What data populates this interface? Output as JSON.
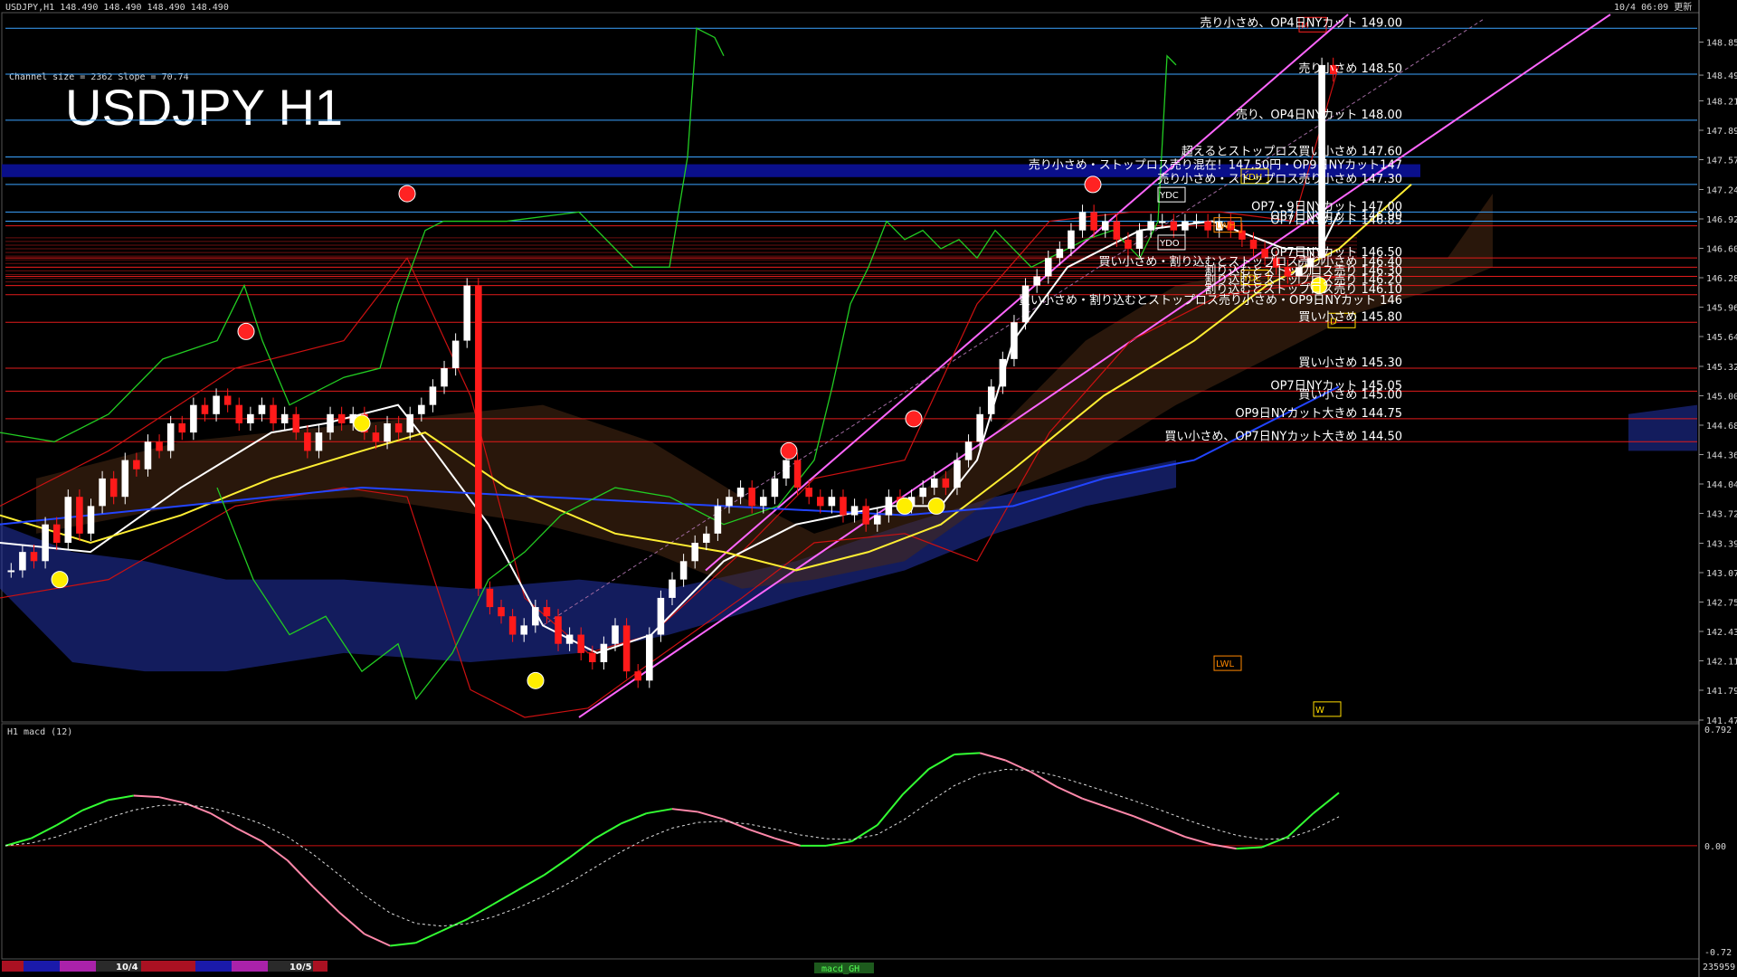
{
  "header": {
    "symbol_line": "USDJPY,H1  148.490 148.490 148.490 148.490",
    "timestamp": "10/4 06:09 更新",
    "channel_info": "Channel size = 2362 Slope = 70.74",
    "chart_title": "USDJPY H1"
  },
  "macd_header": "H1  macd (12)",
  "macd_tag": "macd_GH",
  "corner_counter": "235959",
  "chart_data": {
    "type": "line",
    "title": "USDJPY H1",
    "price_axis": {
      "ylim": [
        141.47,
        149.17
      ],
      "ticks": [
        "148.850",
        "148.490",
        "148.210",
        "147.890",
        "147.570",
        "147.245",
        "146.925",
        "146.605",
        "146.285",
        "145.965",
        "145.645",
        "145.320",
        "145.000",
        "144.680",
        "144.360",
        "144.040",
        "143.720",
        "143.395",
        "143.075",
        "142.755",
        "142.435",
        "142.115",
        "141.795",
        "141.470"
      ]
    },
    "macd_axis": {
      "ticks": [
        "0.792",
        "0.00",
        "-0.72"
      ],
      "ylim": [
        -0.72,
        0.792
      ]
    },
    "date_labels": [
      "10/4",
      "10/5"
    ],
    "price_series": {
      "name": "USDJPY",
      "close": [
        143.1,
        143.3,
        143.2,
        143.6,
        143.4,
        143.9,
        143.5,
        143.8,
        144.1,
        143.9,
        144.3,
        144.2,
        144.5,
        144.4,
        144.7,
        144.6,
        144.9,
        144.8,
        145.0,
        144.9,
        144.7,
        144.8,
        144.9,
        144.7,
        144.8,
        144.6,
        144.4,
        144.6,
        144.8,
        144.7,
        144.8,
        144.6,
        144.5,
        144.7,
        144.6,
        144.8,
        144.9,
        145.1,
        145.3,
        145.6,
        146.2,
        142.9,
        142.7,
        142.6,
        142.4,
        142.5,
        142.7,
        142.6,
        142.3,
        142.4,
        142.2,
        142.1,
        142.3,
        142.5,
        142.0,
        141.9,
        142.4,
        142.8,
        143.0,
        143.2,
        143.4,
        143.5,
        143.8,
        143.9,
        144.0,
        143.8,
        143.9,
        144.1,
        144.3,
        144.0,
        143.9,
        143.8,
        143.9,
        143.7,
        143.8,
        143.6,
        143.7,
        143.9,
        143.8,
        143.9,
        144.0,
        144.1,
        144.0,
        144.3,
        144.5,
        144.8,
        145.1,
        145.4,
        145.8,
        146.2,
        146.3,
        146.5,
        146.6,
        146.8,
        147.0,
        146.8,
        146.9,
        146.7,
        146.6,
        146.8,
        146.9,
        146.9,
        146.8,
        146.9,
        146.9,
        146.8,
        146.9,
        146.8,
        146.7,
        146.6,
        146.5,
        146.4,
        146.3,
        146.4,
        146.5,
        148.6,
        148.5
      ]
    },
    "macd_series": {
      "name": "macd (12)",
      "values": [
        0.0,
        0.05,
        0.14,
        0.24,
        0.31,
        0.34,
        0.33,
        0.29,
        0.22,
        0.12,
        0.03,
        -0.1,
        -0.28,
        -0.45,
        -0.6,
        -0.68,
        -0.66,
        -0.58,
        -0.5,
        -0.4,
        -0.3,
        -0.2,
        -0.08,
        0.05,
        0.15,
        0.22,
        0.25,
        0.23,
        0.18,
        0.11,
        0.05,
        0.0,
        0.0,
        0.03,
        0.14,
        0.35,
        0.52,
        0.62,
        0.63,
        0.58,
        0.5,
        0.4,
        0.32,
        0.26,
        0.2,
        0.13,
        0.06,
        0.01,
        -0.02,
        -0.01,
        0.06,
        0.22,
        0.36
      ]
    },
    "horizontal_levels": [
      {
        "price": 149.0,
        "color": "#3ba3ff"
      },
      {
        "price": 148.5,
        "color": "#3ba3ff"
      },
      {
        "price": 148.0,
        "color": "#3ba3ff"
      },
      {
        "price": 147.6,
        "color": "#3ba3ff"
      },
      {
        "price": 147.3,
        "color": "#3ba3ff"
      },
      {
        "price": 147.0,
        "color": "#3ba3ff"
      },
      {
        "price": 146.9,
        "color": "#3ba3ff"
      },
      {
        "price": 146.85,
        "color": "#e21b1b"
      },
      {
        "price": 146.5,
        "color": "#e21b1b"
      },
      {
        "price": 146.4,
        "color": "#e21b1b"
      },
      {
        "price": 146.3,
        "color": "#e21b1b"
      },
      {
        "price": 146.2,
        "color": "#e21b1b"
      },
      {
        "price": 146.1,
        "color": "#e21b1b"
      },
      {
        "price": 145.8,
        "color": "#e21b1b"
      },
      {
        "price": 145.3,
        "color": "#e21b1b"
      },
      {
        "price": 145.05,
        "color": "#e21b1b"
      },
      {
        "price": 144.75,
        "color": "#e21b1b"
      },
      {
        "price": 144.5,
        "color": "#e21b1b"
      }
    ],
    "annotations": [
      {
        "text": "売り小さめ、OP4日NYカット 149.00",
        "price": 149.0
      },
      {
        "text": "売り小さめ 148.50",
        "price": 148.5
      },
      {
        "text": "売り、OP4日NYカット 148.00",
        "price": 148.0
      },
      {
        "text": "超えるとストップロス買い小さめ 147.60",
        "price": 147.6
      },
      {
        "text": "売り小さめ・ストップロス売り混在！147.50円・OP9日NYカット147",
        "price": 147.45
      },
      {
        "text": "売り小さめ・ストップロス売り小さめ 147.30",
        "price": 147.3
      },
      {
        "text": "OP7・9日NYカット 147.00",
        "price": 147.0
      },
      {
        "text": "OP7日NYカット 146.90",
        "price": 146.9
      },
      {
        "text": "OP7日NYカット 146.85",
        "price": 146.85
      },
      {
        "text": "OP7日NYカット 146.50",
        "price": 146.5
      },
      {
        "text": "買い小さめ・割り込むとストップロス売り小さめ 146.40",
        "price": 146.4
      },
      {
        "text": "割り込むとストップロス売り 146.30",
        "price": 146.3
      },
      {
        "text": "割り込むとストップロス売り 146.20",
        "price": 146.2
      },
      {
        "text": "割り込むとストップロス売り 146.10",
        "price": 146.1
      },
      {
        "text": "買い小さめ・割り込むとストップロス売り小さめ・OP9日NYカット 146",
        "price": 145.98
      },
      {
        "text": "買い小さめ 145.80",
        "price": 145.8
      },
      {
        "text": "買い小さめ 145.30",
        "price": 145.3
      },
      {
        "text": "OP7日NYカット 145.05",
        "price": 145.05
      },
      {
        "text": "買い小さめ 145.00",
        "price": 144.95
      },
      {
        "text": "OP9日NYカット大きめ 144.75",
        "price": 144.75
      },
      {
        "text": "買い小さめ、OP7日NYカット大きめ 144.50",
        "price": 144.5
      }
    ],
    "box_labels": [
      {
        "text": "YDC",
        "color": "#ffffff"
      },
      {
        "text": "YDO",
        "color": "#ffffff"
      },
      {
        "text": "YDH",
        "color": "#ffdd00"
      },
      {
        "text": "YDL",
        "color": "#ffdd00"
      },
      {
        "text": "LWH",
        "color": "#ff8800"
      },
      {
        "text": "LWL",
        "color": "#ff8800"
      },
      {
        "text": "M",
        "color": "#ff2222"
      },
      {
        "text": "W",
        "color": "#ffdd00"
      },
      {
        "text": "D",
        "color": "#ffdd00"
      }
    ]
  },
  "colors": {
    "background": "#000000",
    "bull_candle": "#ffffff",
    "bear_candle": "#ff1a1a",
    "blue_level": "#3ba3ff",
    "red_level": "#e21b1b",
    "ma_white": "#ffffff",
    "ma_yellow": "#ffee33",
    "ma_blue": "#2244ff",
    "bollinger": "#cc1111",
    "lagging_green": "#22cc22",
    "channel_pink": "#ff66ff",
    "cloud_blue": "#2233aa",
    "cloud_orange": "#c08050",
    "macd_green": "#33ff33",
    "macd_pink": "#ff88aa"
  }
}
